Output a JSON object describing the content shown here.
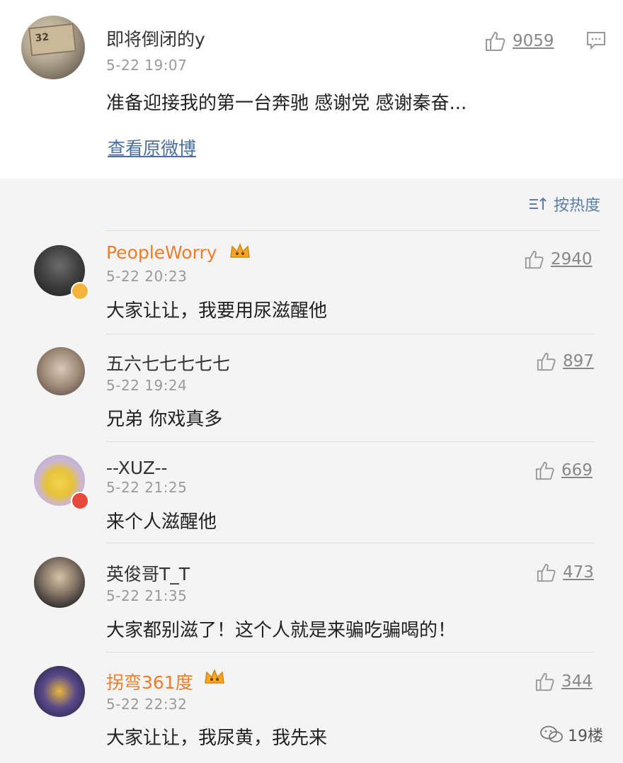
{
  "post": {
    "username": "即将倒闭的y",
    "time": "5-22 19:07",
    "text": "准备迎接我的第一台奔驰 感谢党 感谢秦奋...",
    "likes": "9059",
    "view_original": "查看原微博",
    "avatar_text": "32"
  },
  "sort": {
    "label": "按热度",
    "icon": "sort-icon"
  },
  "comments": [
    {
      "username": "PeopleWorry",
      "time": "5-22 20:23",
      "text": "大家让让，我要用尿滋醒他",
      "likes": "2940",
      "vip": true,
      "verified": true
    },
    {
      "username": "五六七七七七七",
      "time": "5-22 19:24",
      "text": "兄弟 你戏真多",
      "likes": "897",
      "vip": false,
      "verified": false
    },
    {
      "username": "--XUZ--",
      "time": "5-22 21:25",
      "text": "来个人滋醒他",
      "likes": "669",
      "vip": false,
      "verified": true
    },
    {
      "username": "英俊哥T_T",
      "time": "5-22 21:35",
      "text": "大家都别滋了！这个人就是来骗吃骗喝的！",
      "likes": "473",
      "vip": false,
      "verified": false
    },
    {
      "username": "拐弯361度",
      "time": "5-22 22:32",
      "text": "大家让让，我尿黄，我先来",
      "likes": "344",
      "vip": true,
      "verified": false
    }
  ],
  "watermark": {
    "label": "19楼"
  },
  "colors": {
    "link": "#4a6e9e",
    "vip_name": "#f07c2b",
    "sort": "#5b7ea8"
  }
}
